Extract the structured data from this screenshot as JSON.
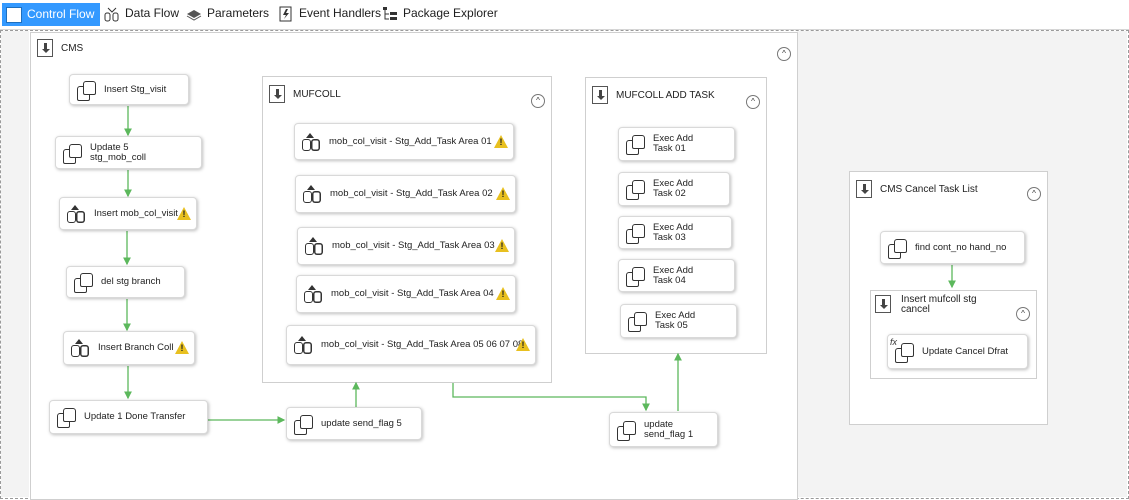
{
  "tabs": [
    {
      "label": "Control Flow",
      "icon": "control-flow-icon",
      "active": true
    },
    {
      "label": "Data Flow",
      "icon": "data-flow-icon"
    },
    {
      "label": "Parameters",
      "icon": "parameters-icon"
    },
    {
      "label": "Event Handlers",
      "icon": "event-handlers-icon"
    },
    {
      "label": "Package Explorer",
      "icon": "package-explorer-icon"
    }
  ],
  "containers": {
    "cms": {
      "title": "CMS"
    },
    "mufcoll": {
      "title": "MUFCOLL"
    },
    "mufcoll_add_task": {
      "title": "MUFCOLL ADD TASK"
    },
    "cms_cancel": {
      "title": "CMS Cancel Task List"
    },
    "insert_mufcoll_stg_cancel": {
      "title": "Insert mufcoll stg cancel"
    }
  },
  "tasks": {
    "insert_stg_visit": "Insert Stg_visit",
    "update5": "Update 5 stg_mob_coll",
    "insert_mob_col_visit": "Insert mob_col_visit",
    "del_stg_branch": "del stg branch",
    "insert_branch_coll": "Insert Branch Coll",
    "update1_done": "Update 1 Done Transfer",
    "update_send_flag5": "update send_flag 5",
    "update_send_flag1": "update send_flag 1",
    "area01": "mob_col_visit - Stg_Add_Task Area 01",
    "area02": "mob_col_visit - Stg_Add_Task Area 02",
    "area03": "mob_col_visit - Stg_Add_Task Area 03",
    "area04": "mob_col_visit - Stg_Add_Task Area 04",
    "area05": "mob_col_visit - Stg_Add_Task Area 05 06 07 08",
    "exec01": "Exec Add Task 01",
    "exec02": "Exec Add Task 02",
    "exec03": "Exec Add Task 03",
    "exec04": "Exec Add Task 04",
    "exec05": "Exec Add Task 05",
    "find_cont_no": "find cont_no hand_no",
    "update_cancel_dfrat": "Update Cancel Dfrat"
  },
  "warning_symbol": "!",
  "collapse_symbol": "^",
  "fx_symbol": "fx",
  "colors": {
    "accent": "#3399ff",
    "connector": "#5cb85c",
    "warning": "#e8c020"
  }
}
